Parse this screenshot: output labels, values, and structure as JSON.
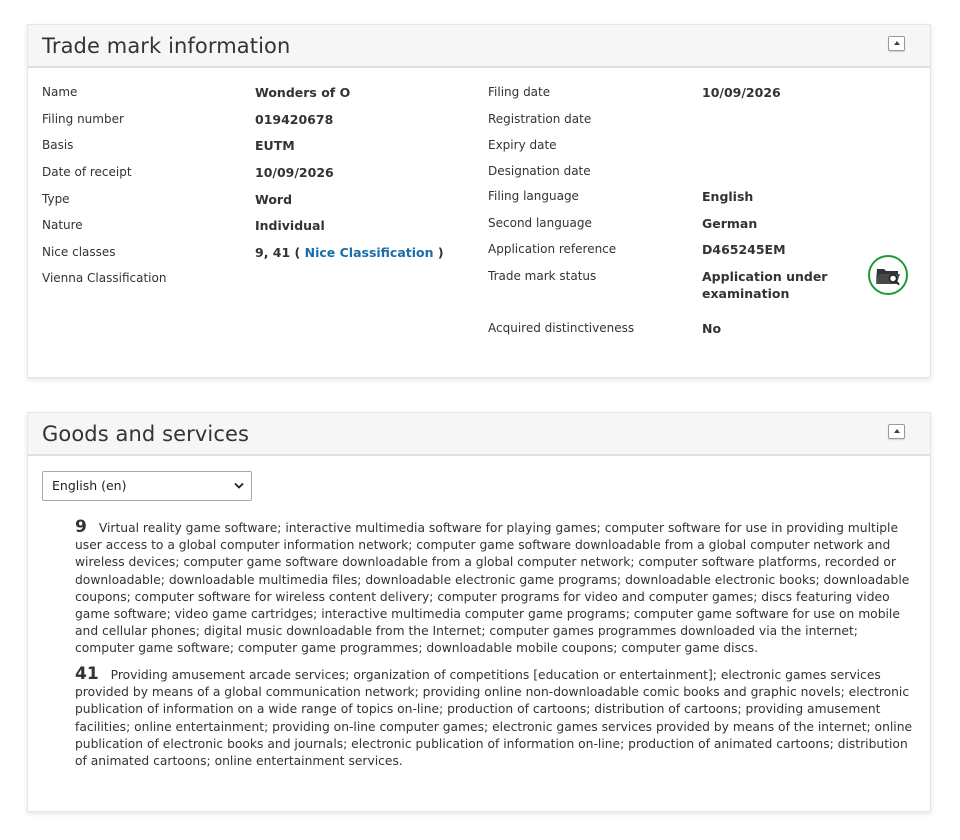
{
  "trademark": {
    "title": "Trade mark information",
    "left": [
      {
        "label": "Name",
        "value": "Wonders of O"
      },
      {
        "label": "Filing number",
        "value": "019420678"
      },
      {
        "label": "Basis",
        "value": "EUTM"
      },
      {
        "label": "Date of receipt",
        "value": "10/09/2026"
      },
      {
        "label": "Type",
        "value": "Word"
      },
      {
        "label": "Nature",
        "value": "Individual"
      },
      {
        "label": "Nice classes",
        "value": "9, 41 (",
        "link": "Nice Classification",
        "suffix": ")"
      },
      {
        "label": "Vienna Classification",
        "value": ""
      }
    ],
    "right": [
      {
        "label": "Filing date",
        "value": "10/09/2026"
      },
      {
        "label": "Registration date",
        "value": ""
      },
      {
        "label": "Expiry date",
        "value": ""
      },
      {
        "label": "Designation date",
        "value": ""
      },
      {
        "label": "Filing language",
        "value": "English"
      },
      {
        "label": "Second language",
        "value": "German"
      },
      {
        "label": "Application reference",
        "value": "D465245EM"
      },
      {
        "label": "Trade mark status",
        "value": "Application under examination"
      },
      {
        "label": "Acquired distinctiveness",
        "value": "No"
      }
    ],
    "status_icon": "folder-search-icon",
    "status_color": "#1e9a3a"
  },
  "goods": {
    "title": "Goods and services",
    "language_selected": "English (en)",
    "classes": [
      {
        "number": "9",
        "text": "Virtual reality game software; interactive multimedia software for playing games; computer software for use in providing multiple user access to a global computer information network; computer game software downloadable from a global computer network and wireless devices; computer game software downloadable from a global computer network; computer software platforms, recorded or downloadable; downloadable multimedia files; downloadable electronic game programs; downloadable electronic books; downloadable coupons; computer software for wireless content delivery; computer programs for video and computer games; discs featuring video game software; video game cartridges; interactive multimedia computer game programs; computer game software for use on mobile and cellular phones; digital music downloadable from the Internet; computer games programmes downloaded via the internet; computer game software; computer game programmes; downloadable mobile coupons; computer game discs."
      },
      {
        "number": "41",
        "text": "Providing amusement arcade services; organization of competitions [education or entertainment]; electronic games services provided by means of a global communication network; providing online non-downloadable comic books and graphic novels; electronic publication of information on a wide range of topics on-line; production of cartoons; distribution of cartoons; providing amusement facilities; online entertainment; providing on-line computer games; electronic games services provided by means of the internet; online publication of electronic books and journals; electronic publication of information on-line; production of animated cartoons; distribution of animated cartoons; online entertainment services."
      }
    ]
  },
  "colors": {
    "link": "#1a6ea8",
    "header_bg": "#f6f6f6"
  }
}
